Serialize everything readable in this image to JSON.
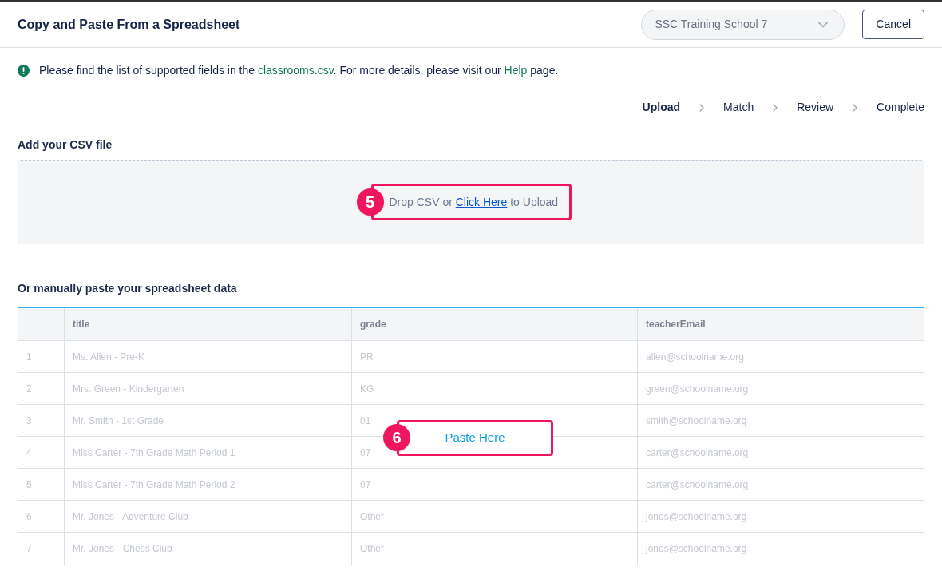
{
  "header": {
    "title": "Copy and Paste From a Spreadsheet",
    "school_select": {
      "value": "SSC Training School 7"
    },
    "cancel_button": "Cancel"
  },
  "notice": {
    "parts": [
      {
        "kind": "text",
        "text": "Please find the list of supported fields in the "
      },
      {
        "kind": "link",
        "text": "classrooms.csv"
      },
      {
        "kind": "text",
        "text": ". For more details, please visit our "
      },
      {
        "kind": "link",
        "text": "Help"
      },
      {
        "kind": "text",
        "text": " page."
      }
    ]
  },
  "steps": [
    {
      "label": "Upload",
      "selected": true
    },
    {
      "label": "Match",
      "selected": false
    },
    {
      "label": "Review",
      "selected": false
    },
    {
      "label": "Complete",
      "selected": false
    }
  ],
  "upload": {
    "label": "Add your CSV file",
    "before": "Drop CSV or ",
    "link": "Click Here",
    "after": " to Upload",
    "annotation": "5"
  },
  "paste": {
    "label": "Or manually paste your spreadsheet data",
    "prompt": "Paste Here",
    "annotation": "6"
  },
  "table": {
    "columns": [
      "title",
      "grade",
      "teacherEmail"
    ],
    "rows": [
      {
        "number": "1",
        "cells": [
          "Ms. Allen - Pre-K",
          "PR",
          "allen@schoolname.org"
        ]
      },
      {
        "number": "2",
        "cells": [
          "Mrs. Green - Kindergarten",
          "KG",
          "green@schoolname.org"
        ]
      },
      {
        "number": "3",
        "cells": [
          "Mr. Smith - 1st Grade",
          "01",
          "smith@schoolname.org"
        ]
      },
      {
        "number": "4",
        "cells": [
          "Miss Carter - 7th Grade Math Period 1",
          "07",
          "carter@schoolname.org"
        ]
      },
      {
        "number": "5",
        "cells": [
          "Miss Carter - 7th Grade Math Period 2",
          "07",
          "carter@schoolname.org"
        ]
      },
      {
        "number": "6",
        "cells": [
          "Mr. Jones - Adventure Club",
          "Other",
          "jones@schoolname.org"
        ]
      },
      {
        "number": "7",
        "cells": [
          "Mr. Jones - Chess Club",
          "Other",
          "jones@schoolname.org"
        ]
      }
    ]
  }
}
